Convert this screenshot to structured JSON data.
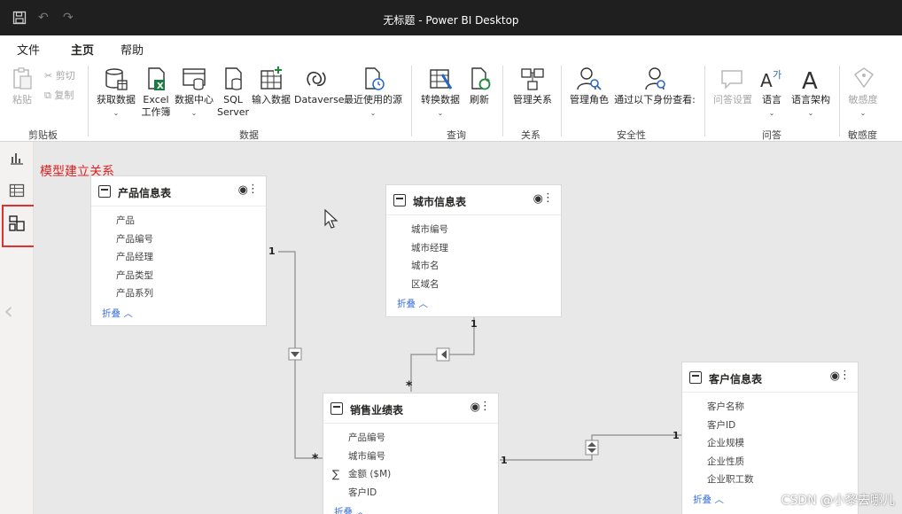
{
  "window": {
    "title": "无标题 - Power BI Desktop"
  },
  "menu": {
    "tabs": [
      "文件",
      "主页",
      "帮助"
    ]
  },
  "ribbon": {
    "clipboard": {
      "paste": "粘贴",
      "cut": "剪切",
      "copy": "复制",
      "group": "剪贴板"
    },
    "data": {
      "get_data": "获取数据",
      "excel_line1": "Excel",
      "excel_line2": "工作簿",
      "datahub": "数据中心",
      "sql_line1": "SQL",
      "sql_line2": "Server",
      "enter_data": "输入数据",
      "dataverse": "Dataverse",
      "recent": "最近使用的源",
      "group": "数据"
    },
    "query": {
      "transform": "转换数据",
      "refresh": "刷新",
      "group": "查询"
    },
    "relationships": {
      "manage": "管理关系",
      "group": "关系"
    },
    "security": {
      "manage_roles": "管理角色",
      "view_as": "通过以下身份查看:",
      "group": "安全性"
    },
    "qa": {
      "setup": "问答设置",
      "language": "语言",
      "schema": "语言架构",
      "group": "问答"
    },
    "sensitivity": {
      "btn": "敏感度",
      "group": "敏感度"
    }
  },
  "annotation": "模型建立关系",
  "tables": {
    "product": {
      "name": "产品信息表",
      "fields": [
        "产品",
        "产品编号",
        "产品经理",
        "产品类型",
        "产品系列"
      ],
      "collapse": "折叠 ︿"
    },
    "city": {
      "name": "城市信息表",
      "fields": [
        "城市编号",
        "城市经理",
        "城市名",
        "区域名"
      ],
      "collapse": "折叠 ︿"
    },
    "sales": {
      "name": "销售业绩表",
      "fields": [
        "产品编号",
        "城市编号",
        "金额 ($M)",
        "客户ID"
      ],
      "collapse": "折叠 ︿"
    },
    "customer": {
      "name": "客户信息表",
      "fields": [
        "客户名称",
        "客户ID",
        "企业规模",
        "企业性质",
        "企业职工数"
      ],
      "collapse": "折叠 ︿"
    }
  },
  "relations": {
    "one": "1",
    "many": "*"
  },
  "watermark": "CSDN @小黎去哪儿"
}
